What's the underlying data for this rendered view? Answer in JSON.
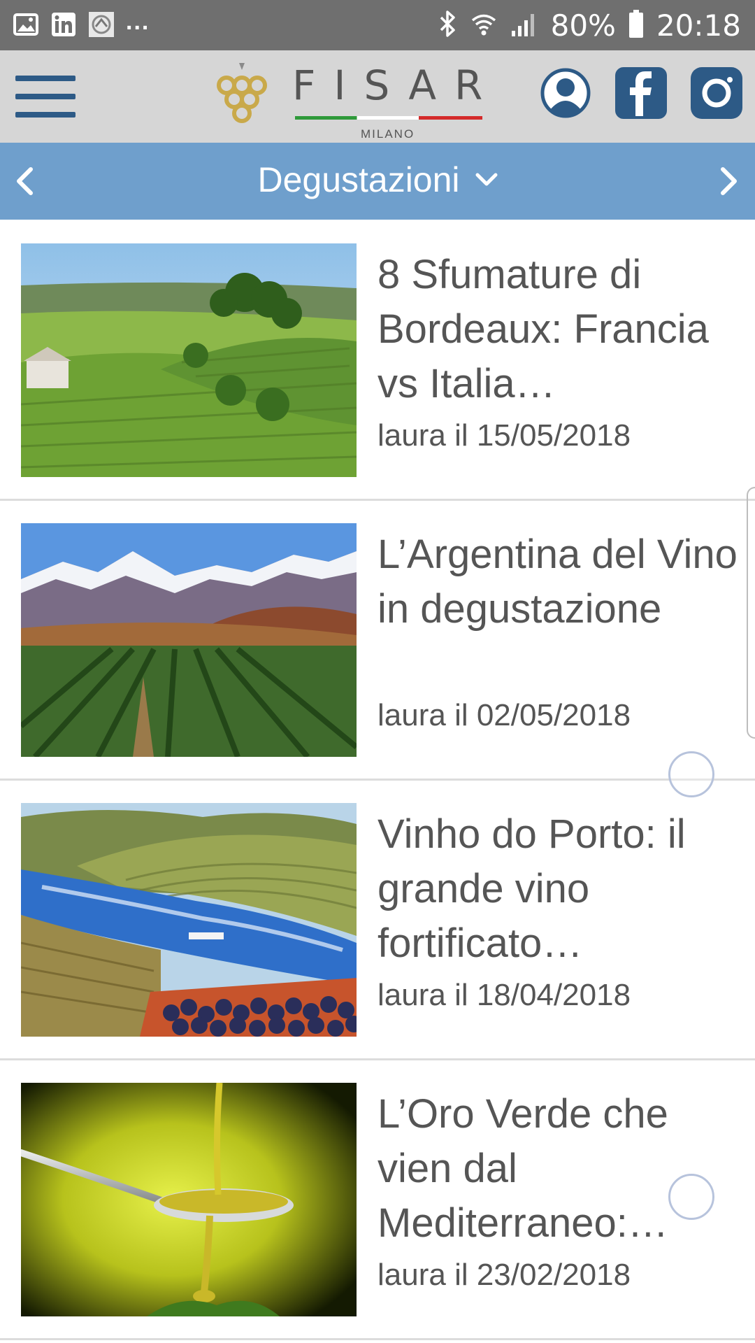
{
  "status_bar": {
    "battery": "80%",
    "time": "20:18",
    "more": "..."
  },
  "header": {
    "logo_text": "FISAR",
    "logo_subtitle": "MILANO"
  },
  "category": {
    "label": "Degustazioni"
  },
  "articles": [
    {
      "title": "8 Sfumature di Bordeaux: Francia vs Italia…",
      "meta": "laura il 15/05/2018"
    },
    {
      "title": "L’Argentina del Vino in degustazione",
      "meta": "laura il 02/05/2018"
    },
    {
      "title": "Vinho do Porto: il grande vino fortificato…",
      "meta": "laura il 18/04/2018"
    },
    {
      "title": "L’Oro Verde che vien dal Mediterraneo:…",
      "meta": "laura il 23/02/2018"
    }
  ],
  "colors": {
    "status_bar": "#6f6f6f",
    "header_bg": "#d6d6d6",
    "brand_blue": "#2d5a86",
    "category_bar": "#6f9fcc",
    "text": "#555555"
  }
}
